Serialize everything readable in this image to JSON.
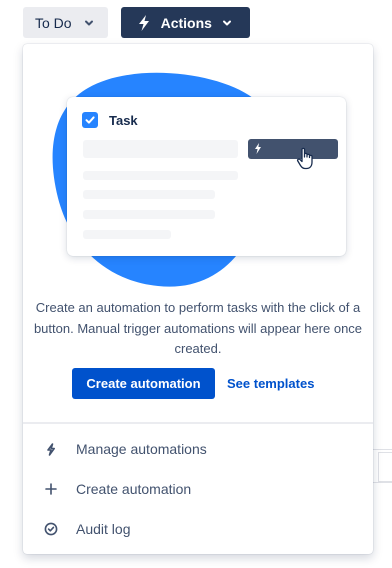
{
  "toolbar": {
    "status_label": "To Do",
    "actions_label": "Actions"
  },
  "card": {
    "title": "Task"
  },
  "empty_state": {
    "description": "Create an automation to perform tasks with the click of a button. Manual trigger automations will appear here once created.",
    "primary_button": "Create automation",
    "secondary_link": "See templates"
  },
  "menu": {
    "items": [
      {
        "label": "Manage automations",
        "icon": "bolt-outline-icon"
      },
      {
        "label": "Create automation",
        "icon": "plus-icon"
      },
      {
        "label": "Audit log",
        "icon": "check-circle-icon"
      }
    ]
  },
  "colors": {
    "primary": "#0052cc",
    "actions_bg": "#253858",
    "status_bg": "#ebecf0",
    "blob": "#2684ff",
    "subtle_text": "#42526e"
  }
}
